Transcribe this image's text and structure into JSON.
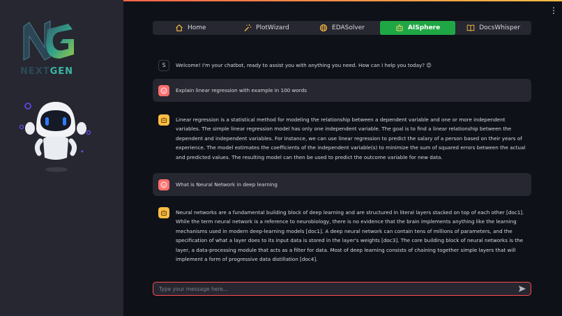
{
  "brand": {
    "logo_text_a": "NEXT",
    "logo_text_b": "GEN"
  },
  "colors": {
    "accent": "#ff4b4b",
    "active_tab": "#20a745",
    "user_avatar": "#ff6e6e",
    "bot_avatar": "#ffbd45"
  },
  "nav": {
    "items": [
      {
        "label": "Home",
        "icon": "house-icon"
      },
      {
        "label": "PlotWizard",
        "icon": "magic-wand-icon"
      },
      {
        "label": "EDASolver",
        "icon": "globe-icon"
      },
      {
        "label": "AISphere",
        "icon": "robot-icon",
        "active": true
      },
      {
        "label": "DocsWhisper",
        "icon": "book-icon"
      }
    ]
  },
  "messages": [
    {
      "role": "system",
      "avatar": "S",
      "text": "Welcome! I'm your chatbot, ready to assist you with anything you need. How can I help you today? 😊"
    },
    {
      "role": "user",
      "text": "Explain linear regression with example in 100 words"
    },
    {
      "role": "assistant",
      "text": "Linear regression is a statistical method for modeling the relationship between a dependent variable and one or more independent variables. The simple linear regression model has only one independent variable. The goal is to find a linear relationship between the dependent and independent variables. For instance, we can use linear regression to predict the salary of a person based on their years of experience. The model estimates the coefficients of the independent variable(s) to minimize the sum of squared errors between the actual and predicted values. The resulting model can then be used to predict the outcome variable for new data."
    },
    {
      "role": "user",
      "text": "What is Neural Network in deep learning"
    },
    {
      "role": "assistant",
      "text": "Neural networks are a fundamental building block of deep learning and are structured in literal layers stacked on top of each other [doc1]. While the term neural network is a reference to neurobiology, there is no evidence that the brain implements anything like the learning mechanisms used in modern deep-learning models [doc1]. A deep neural network can contain tens of millions of parameters, and the specification of what a layer does to its input data is stored in the layer's weights [doc3]. The core building block of neural networks is the layer, a data-processing module that acts as a filter for data. Most of deep learning consists of chaining together simple layers that will implement a form of progressive data distillation [doc4]."
    }
  ],
  "chat_input": {
    "placeholder": "Type your message here..."
  }
}
